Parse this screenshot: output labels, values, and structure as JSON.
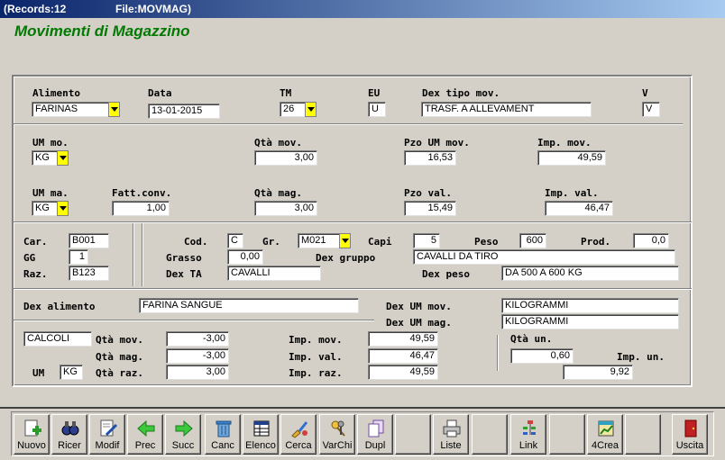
{
  "window": {
    "records": "(Records:12",
    "file": "File:MOVMAG)",
    "title": "Movimenti di Magazzino"
  },
  "colors": {
    "title_green": "#007a00",
    "dropdown_yellow": "#ffff00",
    "titlebar_blue": "#0a246a"
  },
  "row1": {
    "alimento_label": "Alimento",
    "alimento_value": "FARINAS",
    "data_label": "Data",
    "data_value": "13-01-2015",
    "tm_label": "TM",
    "tm_value": "26",
    "eu_label": "EU",
    "eu_value": "U",
    "dex_tipo_label": "Dex tipo mov.",
    "dex_tipo_value": "TRASF. A ALLEVAMENT",
    "v_label": "V",
    "v_value": "V"
  },
  "row2": {
    "um_mo_label": "UM mo.",
    "um_mo_value": "KG",
    "qta_mov_label": "Qtà mov.",
    "qta_mov_value": "3,00",
    "pzo_um_mov_label": "Pzo UM mov.",
    "pzo_um_mov_value": "16,53",
    "imp_mov_label": "Imp. mov.",
    "imp_mov_value": "49,59"
  },
  "row3": {
    "um_ma_label": "UM ma.",
    "um_ma_value": "KG",
    "fatt_conv_label": "Fatt.conv.",
    "fatt_conv_value": "1,00",
    "qta_mag_label": "Qtà mag.",
    "qta_mag_value": "3,00",
    "pzo_val_label": "Pzo val.",
    "pzo_val_value": "15,49",
    "imp_val_label": "Imp. val.",
    "imp_val_value": "46,47"
  },
  "left_box": {
    "car_label": "Car.",
    "car_value": "B001",
    "gg_label": "GG",
    "gg_value": "1",
    "raz_label": "Raz.",
    "raz_value": "B123"
  },
  "right_box": {
    "cod_label": "Cod.",
    "cod_value": "C",
    "gr_label": "Gr.",
    "gr_value": "M021",
    "capi_label": "Capi",
    "capi_value": "5",
    "peso_label": "Peso",
    "peso_value": "600",
    "prod_label": "Prod.",
    "prod_value": "0,0",
    "grasso_label": "Grasso",
    "grasso_value": "0,00",
    "dex_gruppo_label": "Dex gruppo",
    "dex_gruppo_value": "CAVALLI DA TIRO",
    "dex_ta_label": "Dex TA",
    "dex_ta_value": "CAVALLI",
    "dex_peso_label": "Dex peso",
    "dex_peso_value": "DA 500 A 600 KG"
  },
  "bottom": {
    "dex_alimento_label": "Dex alimento",
    "dex_alimento_value": "FARINA SANGUE",
    "dex_um_mov_label": "Dex UM mov.",
    "dex_um_mov_value": "KILOGRAMMI",
    "dex_um_mag_label": "Dex UM mag.",
    "dex_um_mag_value": "KILOGRAMMI",
    "calcoli_value": "CALCOLI",
    "c_qta_mov_label": "Qtà mov.",
    "c_qta_mov_value": "-3,00",
    "c_qta_mag_label": "Qtà mag.",
    "c_qta_mag_value": "-3,00",
    "c_um_label": "UM",
    "c_um_value": "KG",
    "c_qta_raz_label": "Qtà raz.",
    "c_qta_raz_value": "3,00",
    "c_imp_mov_label": "Imp. mov.",
    "c_imp_mov_value": "49,59",
    "c_imp_val_label": "Imp. val.",
    "c_imp_val_value": "46,47",
    "c_imp_raz_label": "Imp. raz.",
    "c_imp_raz_value": "49,59",
    "qta_un_label": "Qtà un.",
    "qta_un_value": "0,60",
    "imp_un_label": "Imp. un.",
    "imp_un_value": "9,92"
  },
  "toolbar": {
    "nuovo": "Nuovo",
    "ricer": "Ricer",
    "modif": "Modif",
    "prec": "Prec",
    "succ": "Succ",
    "canc": "Canc",
    "elenco": "Elenco",
    "cerca": "Cerca",
    "varchi": "VarChi",
    "dupl": "Dupl",
    "liste": "Liste",
    "link": "Link",
    "crea4": "4Crea",
    "uscita": "Uscita"
  }
}
